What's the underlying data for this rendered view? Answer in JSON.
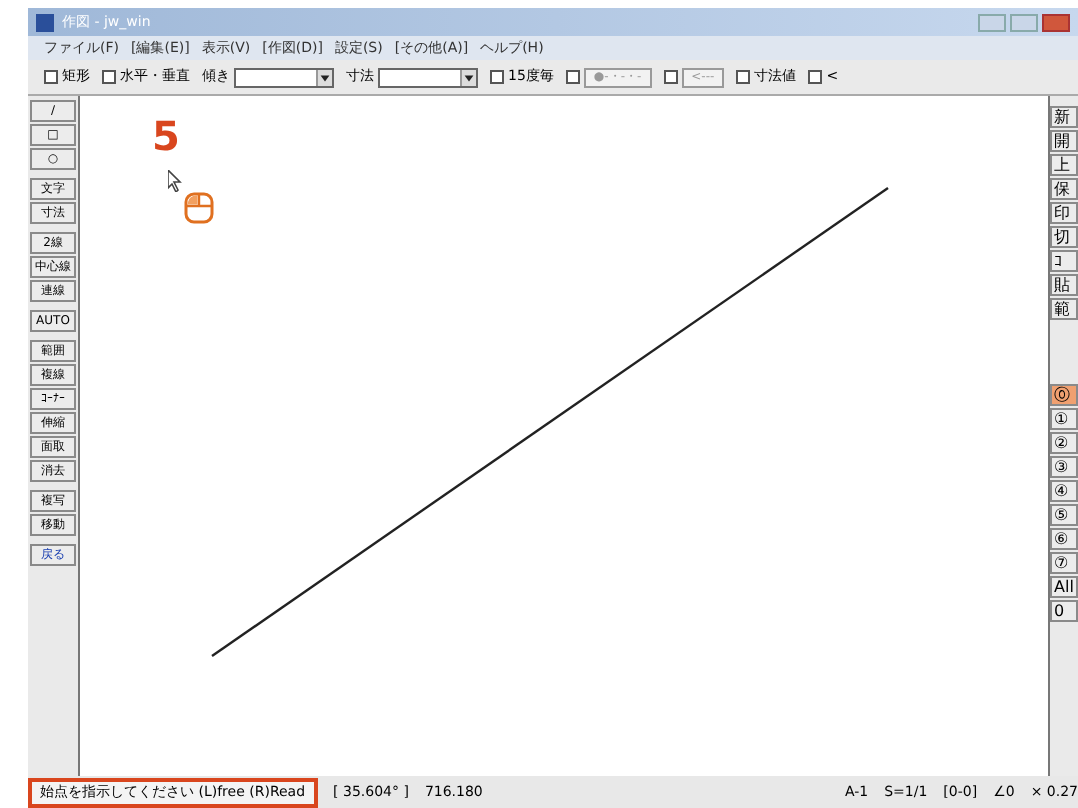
{
  "window": {
    "title": "作図 - jw_win"
  },
  "menu": [
    "ファイル(F)",
    "[編集(E)]",
    "表示(V)",
    "[作図(D)]",
    "設定(S)",
    "[その他(A)]",
    "ヘルプ(H)"
  ],
  "toolbar": [
    {
      "kind": "check",
      "label": "矩形",
      "checked": false
    },
    {
      "kind": "check",
      "label": "水平・垂直",
      "checked": false
    },
    {
      "kind": "combo",
      "label": "傾き"
    },
    {
      "kind": "combo",
      "label": "寸法"
    },
    {
      "kind": "check",
      "label": "15度毎",
      "checked": false
    },
    {
      "kind": "checkbutton",
      "label": "●-・-・-",
      "checked": false
    },
    {
      "kind": "checkbutton",
      "label": "<---",
      "checked": false
    },
    {
      "kind": "check",
      "label": "寸法値",
      "checked": false
    },
    {
      "kind": "check",
      "label": "<",
      "checked": false
    }
  ],
  "left_tools": [
    [
      "/",
      "□",
      "○"
    ],
    [
      "文字",
      "寸法"
    ],
    [
      "2線",
      "中心線",
      "連線"
    ],
    [
      "AUTO"
    ],
    [
      "範囲",
      "複線",
      "ｺｰﾅｰ",
      "伸縮",
      "面取",
      "消去"
    ],
    [
      "複写",
      "移動"
    ],
    [
      "戻る"
    ]
  ],
  "right_tools": [
    "新",
    "開",
    "上",
    "保",
    "印",
    "切",
    "ｺ",
    "貼",
    "範"
  ],
  "layers": [
    {
      "label": "⓪",
      "selected": true
    },
    {
      "label": "①",
      "selected": false
    },
    {
      "label": "②",
      "selected": false
    },
    {
      "label": "③",
      "selected": false
    },
    {
      "label": "④",
      "selected": false
    },
    {
      "label": "⑤",
      "selected": false
    },
    {
      "label": "⑥",
      "selected": false
    },
    {
      "label": "⑦",
      "selected": false
    },
    {
      "label": "All",
      "selected": false
    },
    {
      "label": "0",
      "selected": false
    }
  ],
  "annotation": {
    "step": "5"
  },
  "status_bar": {
    "message": "始点を指示してください (L)free (R)Read",
    "highlighted": true,
    "angle": "[ 35.604° ]",
    "length": "716.180",
    "right": [
      "A-1",
      "S=1/1",
      "[0-0]",
      "∠0",
      "× 0.27"
    ]
  }
}
